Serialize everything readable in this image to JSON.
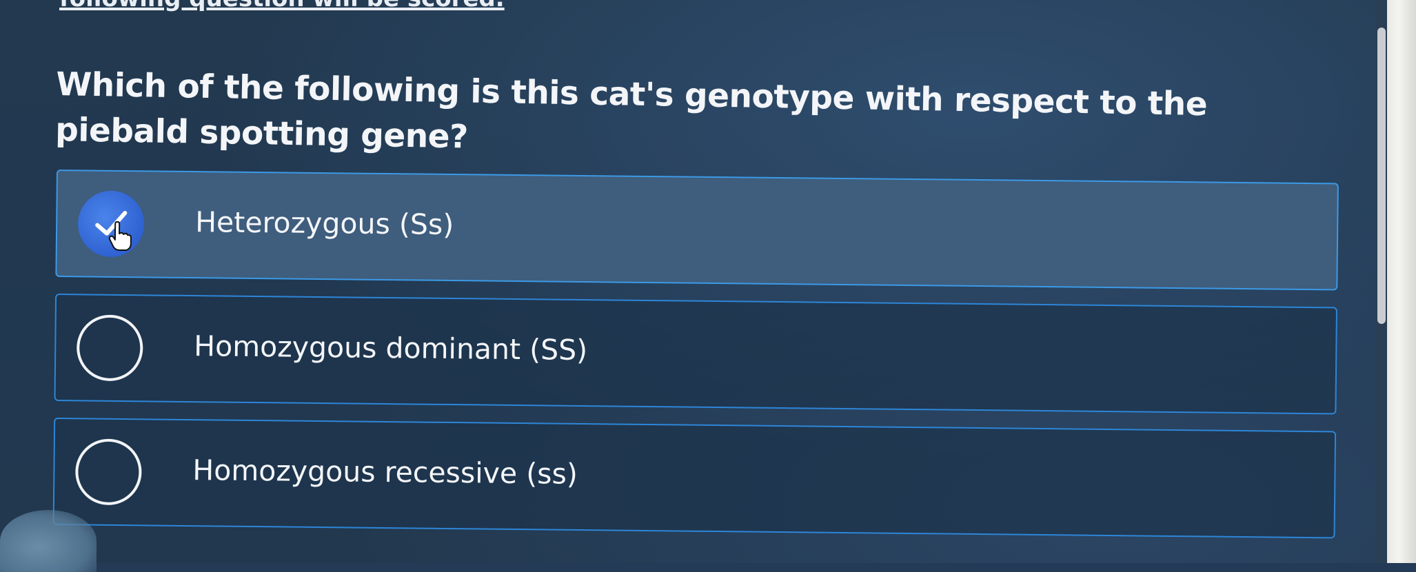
{
  "instructions_text": "following question will be scored.",
  "question": "Which of the following is this cat's genotype with respect to the piebald spotting gene?",
  "options": [
    {
      "label": "Heterozygous (Ss)",
      "selected": true
    },
    {
      "label": "Homozygous dominant (SS)",
      "selected": false
    },
    {
      "label": "Homozygous recessive (ss)",
      "selected": false
    }
  ],
  "colors": {
    "background": "#22394f",
    "option_border": "#2d86d8",
    "selected_radio": "#2f62d2",
    "selected_option_bg": "#3f5d7d",
    "text": "#f3f5f8"
  },
  "icons": {
    "selected_radio": "check-icon",
    "cursor": "hand-pointer-icon"
  }
}
